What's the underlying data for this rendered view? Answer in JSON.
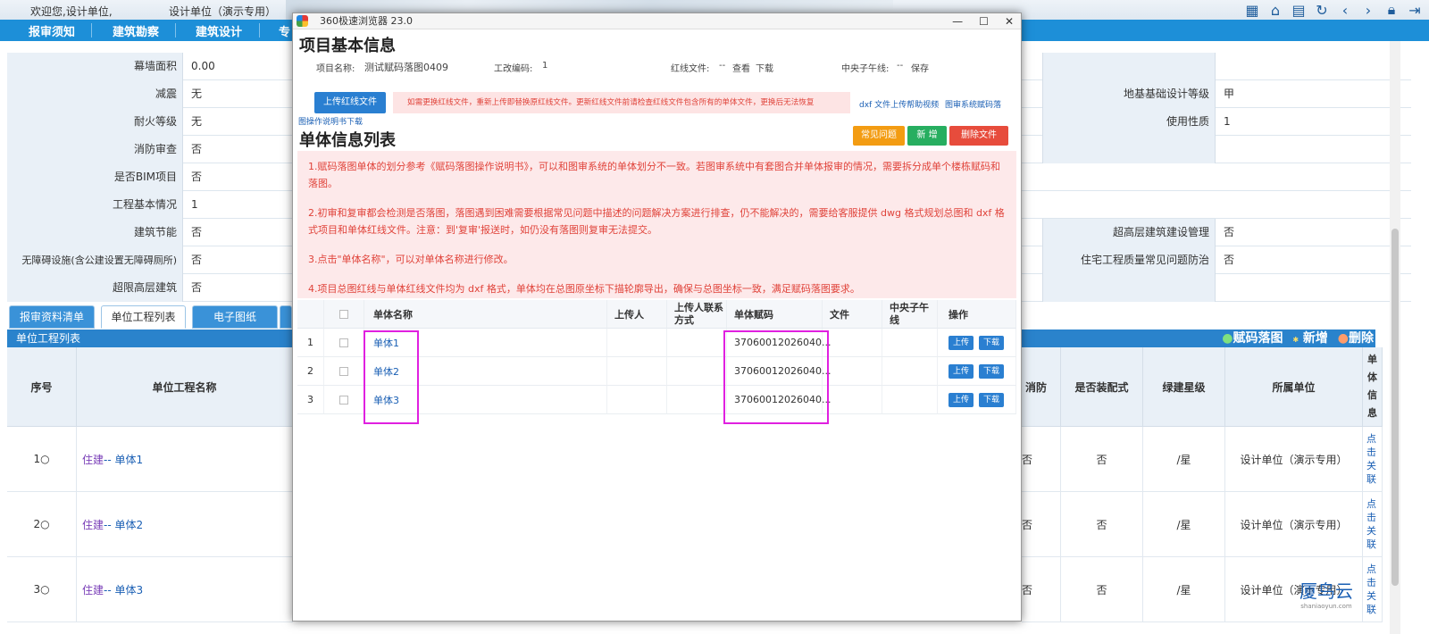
{
  "topbar": {
    "welcome": "欢迎您,设计单位,",
    "unit": "设计单位（演示专用）",
    "icons": [
      "qr-code-icon",
      "home-icon",
      "document-icon",
      "refresh-icon",
      "back-icon",
      "forward-icon",
      "lock-icon",
      "logout-icon"
    ]
  },
  "nav": {
    "items": [
      "报审须知",
      "建筑勘察",
      "建筑设计",
      "专"
    ]
  },
  "form": {
    "rows": [
      {
        "label": "幕墙面积",
        "value": "0.00",
        "rlabel": "",
        "rvalue": ""
      },
      {
        "label": "减震",
        "value": "无",
        "rlabel": "地基基础设计等级",
        "rvalue": "甲"
      },
      {
        "label": "耐火等级",
        "value": "无",
        "rlabel": "使用性质",
        "rvalue": "1"
      },
      {
        "label": "消防审查",
        "value": "否",
        "rlabel": "",
        "rvalue": ""
      },
      {
        "label": "是否BIM项目",
        "value": "否",
        "rlabel": "",
        "rvalue": ""
      },
      {
        "label": "工程基本情况",
        "value": "1",
        "rlabel": "",
        "rvalue": ""
      },
      {
        "label": "建筑节能",
        "value": "否",
        "rlabel": "超高层建筑建设管理",
        "rvalue": "否"
      },
      {
        "label": "无障碍设施(含公建设置无障碍厕所)",
        "value": "否",
        "rlabel": "住宅工程质量常见问题防治",
        "rvalue": "否"
      },
      {
        "label": "超限高层建筑",
        "value": "否",
        "rlabel": "",
        "rvalue": ""
      }
    ]
  },
  "tabs": [
    "报审资料清单",
    "单位工程列表",
    "电子图纸"
  ],
  "list": {
    "title": "单位工程列表",
    "actions": {
      "fall": "赋码落图",
      "add": "新增",
      "del": "删除"
    },
    "headers": {
      "seq": "序号",
      "name": "单位工程名称",
      "fire": "消防",
      "prefab": "是否装配式",
      "green": "绿建星级",
      "unit": "所属单位",
      "info": "单体信息"
    },
    "rows": [
      {
        "seq": "1",
        "type": "住建",
        "name": "-- 单体1",
        "fire": "否",
        "prefab": "否",
        "green": "/星",
        "unit": "设计单位（演示专用）",
        "link": "点击关联"
      },
      {
        "seq": "2",
        "type": "住建",
        "name": "-- 单体2",
        "fire": "否",
        "prefab": "否",
        "green": "/星",
        "unit": "设计单位（演示专用）",
        "link": "点击关联"
      },
      {
        "seq": "3",
        "type": "住建",
        "name": "-- 单体3",
        "fire": "否",
        "prefab": "否",
        "green": "/星",
        "unit": "设计单位（演示专用）",
        "link": "点击关联"
      }
    ]
  },
  "watermark": {
    "brand": "厦鸟云",
    "url": "shaniaoyun.com"
  },
  "modal": {
    "window_title": "360极速浏览器 23.0",
    "controls": [
      "—",
      "☐",
      "✕"
    ],
    "section_title": "项目基本信息",
    "info": {
      "name_label": "项目名称:",
      "name_value": "测试赋码落图0409",
      "code_label": "工改编码:",
      "code_value": "1",
      "redline_label": "红线文件:",
      "redline_value": "--",
      "view": "查看",
      "download": "下载",
      "meridian_label": "中央子午线:",
      "meridian_value": "--",
      "save": "保存"
    },
    "upload_btn": "上传红线文件",
    "warning": "如需更换红线文件，重新上传即替换原红线文件。更新红线文件前请检查红线文件包含所有的单体文件，更换后无法恢复",
    "help_video": "dxf 文件上传帮助视频",
    "manual_link": "图审系统赋码落",
    "manual_link2": "图操作说明书下载",
    "list_title": "单体信息列表",
    "buttons": {
      "faq": "常见问题",
      "add": "新 增",
      "delete": "删除文件"
    },
    "notices": [
      "1.赋码落图单体的划分参考《赋码落图操作说明书》，可以和图审系统的单体划分不一致。若图审系统中有套图合并单体报审的情况，需要拆分成单个楼栋赋码和落图。",
      "2.初审和复审都会检测是否落图，落图遇到困难需要根据常见问题中描述的问题解决方案进行排查，仍不能解决的，需要给客服提供 dwg 格式规划总图和 dxf 格式项目和单体红线文件。注意：到'复审'报送时，如仍没有落图则复审无法提交。",
      "3.点击\"单体名称\"，可以对单体名称进行修改。",
      "4.项目总图红线与单体红线文件均为 dxf 格式，单体均在总图原坐标下描轮廓导出，确保与总图坐标一致，满足赋码落图要求。"
    ],
    "table": {
      "headers": {
        "name": "单体名称",
        "uploader": "上传人",
        "contact": "上传人联系方式",
        "code": "单体赋码",
        "file": "文件",
        "meridian": "中央子午线",
        "op": "操作"
      },
      "rows": [
        {
          "idx": "1",
          "name": "单体1",
          "code": "37060012026040...",
          "up": "上传",
          "down": "下载"
        },
        {
          "idx": "2",
          "name": "单体2",
          "code": "37060012026040...",
          "up": "上传",
          "down": "下载"
        },
        {
          "idx": "3",
          "name": "单体3",
          "code": "37060012026040...",
          "up": "上传",
          "down": "下载"
        }
      ]
    }
  },
  "colors": {
    "nav": "#1d8fd8",
    "accent": "#2a7fd1",
    "faq": "#f39c12",
    "add": "#27ae60",
    "delete": "#e74c3c",
    "highlight": "#e020e0"
  }
}
